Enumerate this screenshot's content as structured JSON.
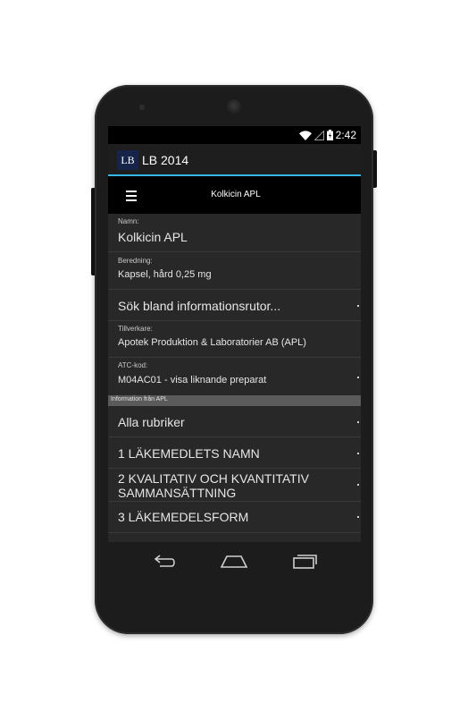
{
  "status_bar": {
    "time": "2:42",
    "icons": [
      "wifi-icon",
      "signal-icon",
      "battery-icon"
    ]
  },
  "action_bar": {
    "app_icon_text": "LB",
    "title": "LB 2014"
  },
  "toolbar": {
    "title": "Kolkicin APL",
    "menu_icon": "hamburger-menu-icon"
  },
  "details": {
    "name": {
      "label": "Namn:",
      "value": "Kolkicin APL"
    },
    "formulation": {
      "label": "Beredning:",
      "value": "Kapsel, hård 0,25 mg"
    },
    "search_info": "Sök bland informationsrutor...",
    "manufacturer": {
      "label": "Tillverkare:",
      "value": "Apotek Produktion & Laboratorier AB (APL)"
    },
    "atc": {
      "label": "ATC-kod:",
      "value": "M04AC01 - visa liknande preparat"
    }
  },
  "section": {
    "header": "Information från APL",
    "items": [
      "Alla rubriker",
      "1 LÄKEMEDLETS NAMN",
      "2 KVALITATIV OCH KVANTITATIV SAMMANSÄTTNING",
      "3 LÄKEMEDELSFORM"
    ]
  },
  "nav_bar": [
    "back-icon",
    "home-icon",
    "recent-apps-icon"
  ],
  "colors": {
    "accent": "#33b5e5",
    "app_icon_bg": "#16244a",
    "list_bg": "#282828"
  }
}
